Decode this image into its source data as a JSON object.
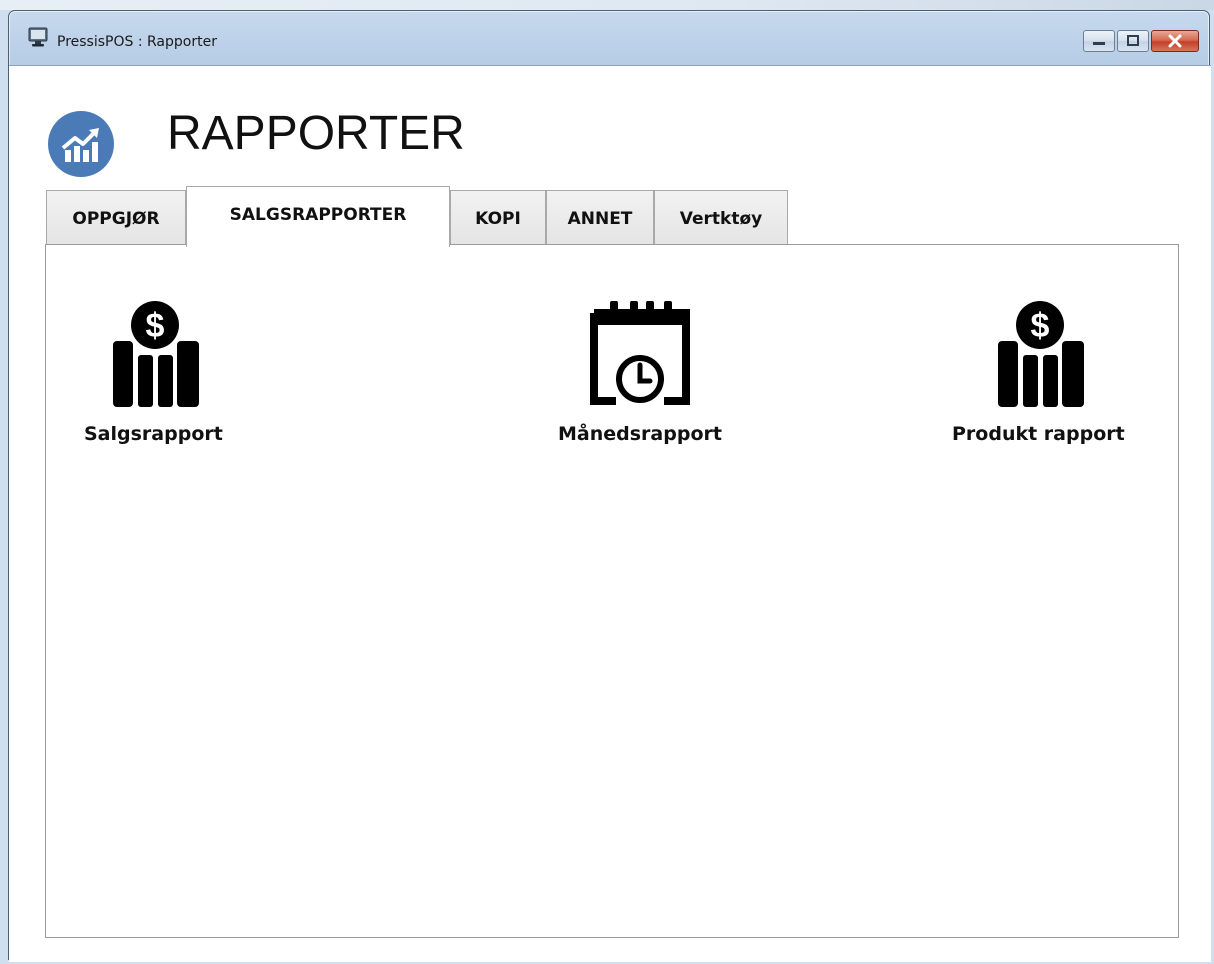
{
  "window": {
    "title": "PressisPOS : Rapporter"
  },
  "header": {
    "title": "RAPPORTER"
  },
  "tabs": [
    {
      "label": "OPPGJØR",
      "active": false
    },
    {
      "label": "SALGSRAPPORTER",
      "active": true
    },
    {
      "label": "KOPI",
      "active": false
    },
    {
      "label": "ANNET",
      "active": false
    },
    {
      "label": "Vertktøy",
      "active": false
    }
  ],
  "reports": [
    {
      "label": "Salgsrapport",
      "icon": "dollar-bar-chart-icon"
    },
    {
      "label": "Månedsrapport",
      "icon": "calendar-clock-icon"
    },
    {
      "label": "Produkt rapport",
      "icon": "dollar-bar-chart-icon"
    }
  ],
  "colors": {
    "logo_circle": "#4a7bb7",
    "icon_fill": "#000000",
    "close_button": "#c7432c"
  }
}
